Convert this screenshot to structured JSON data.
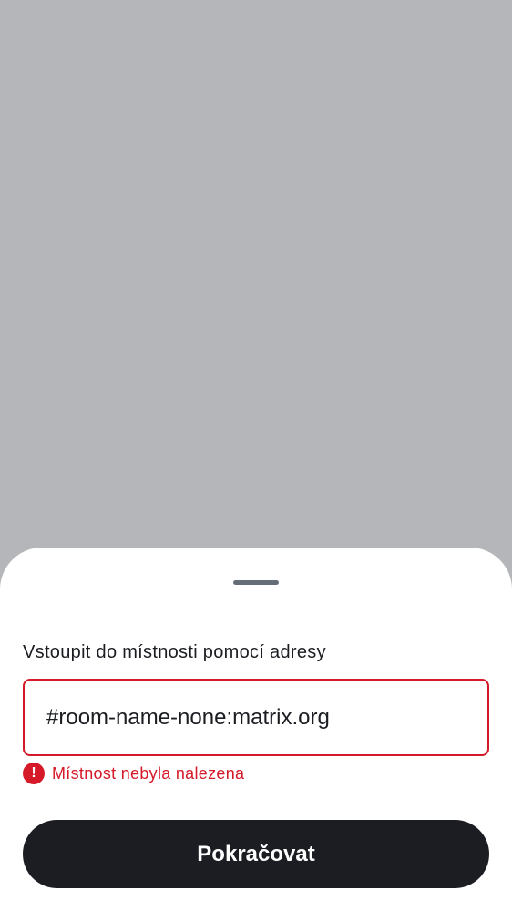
{
  "sheet": {
    "field_label": "Vstoupit do místnosti pomocí adresy",
    "address_value": "#room-name-none:matrix.org",
    "error_icon": "!",
    "error_message": "Místnost nebyla nalezena",
    "continue_label": "Pokračovat"
  },
  "icons": {
    "error": "error-exclamation-icon",
    "handle": "drag-handle"
  },
  "colors": {
    "scrim": "#b5b6b9",
    "error": "#d51928",
    "primary_button": "#1b1d22",
    "text": "#1b1d22"
  }
}
